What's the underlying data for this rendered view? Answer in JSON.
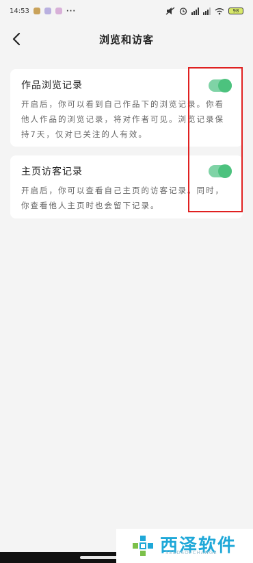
{
  "status_bar": {
    "time": "14:53",
    "battery": "98"
  },
  "header": {
    "title": "浏览和访客"
  },
  "cards": [
    {
      "title": "作品浏览记录",
      "description": "开启后，你可以看到自己作品下的浏览记录。你看他人作品的浏览记录，将对作者可见。浏览记录保持7天，仅对已关注的人有效。",
      "toggle_on": true
    },
    {
      "title": "主页访客记录",
      "description": "开启后，你可以查看自己主页的访客记录。同时，你查看他人主页时也会留下记录。",
      "toggle_on": true
    }
  ],
  "colors": {
    "toggle_track": "#7fd3a6",
    "toggle_knob": "#4cc27e",
    "highlight": "#e02020",
    "watermark": "#1fa8d8"
  },
  "watermark": {
    "title": "西泽软件",
    "subtitle": "SEEDSOFCHANGE"
  },
  "icons": {
    "back": "chevron-left-icon",
    "wifi": "wifi-icon",
    "alarm": "alarm-icon",
    "mute": "mute-icon",
    "signal": "signal-icon",
    "battery": "battery-icon"
  }
}
